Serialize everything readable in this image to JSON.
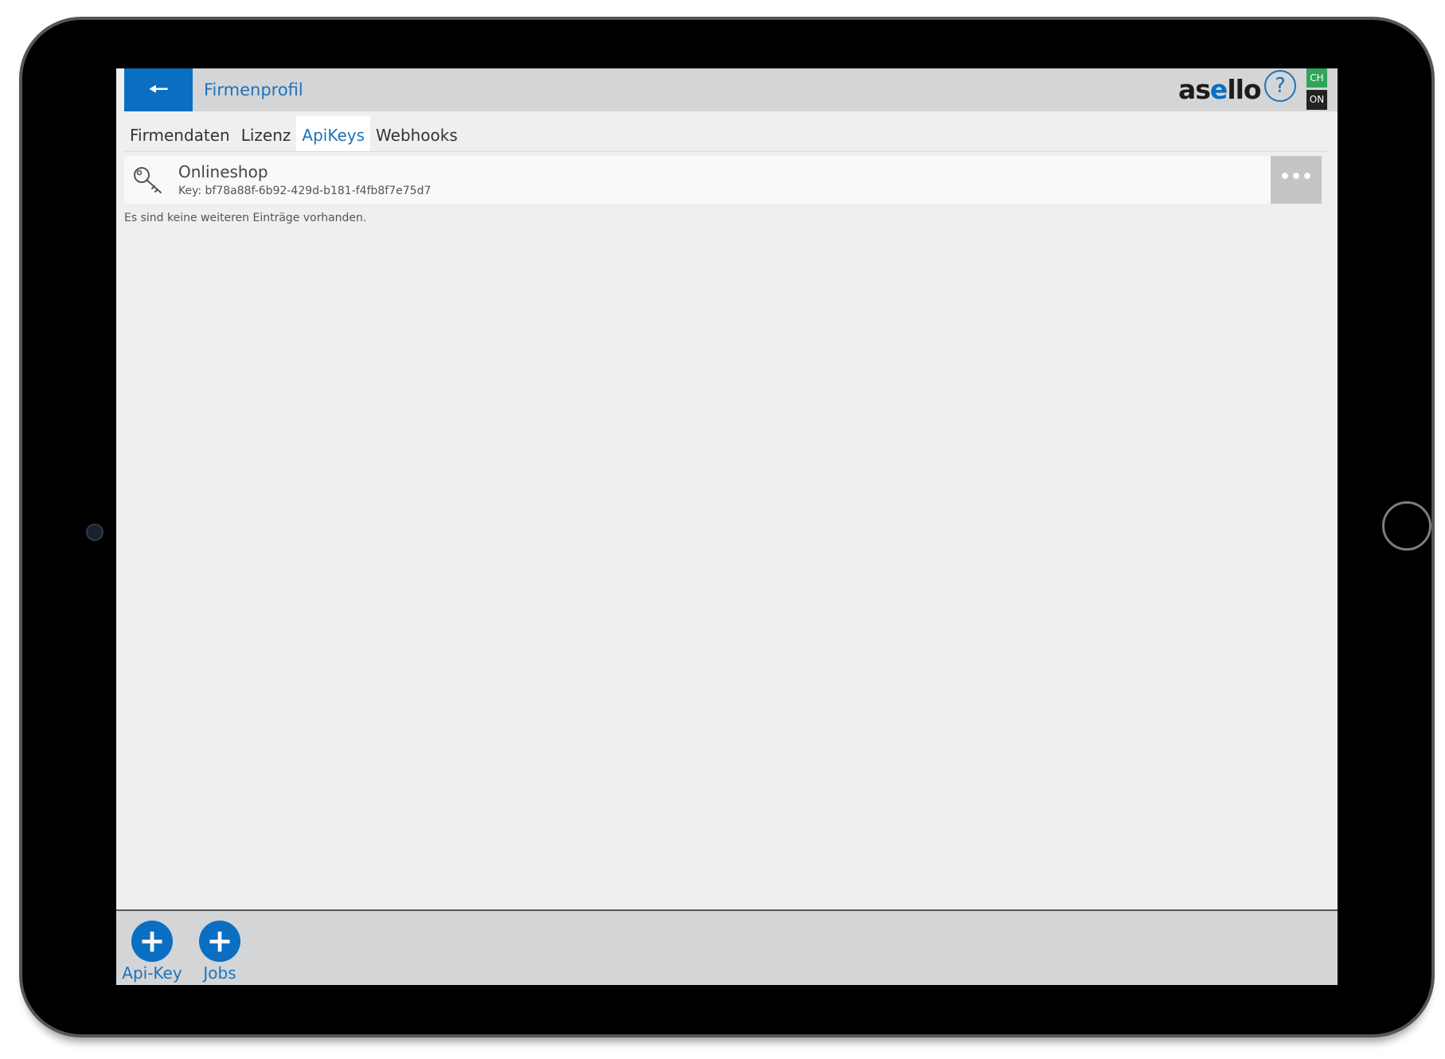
{
  "header": {
    "back_icon": "arrow-left-icon",
    "title": "Firmenprofil",
    "logo": {
      "before": "as",
      "accent": "e",
      "after": "llo"
    },
    "help_glyph": "?",
    "badges": {
      "ch": "CH",
      "on": "ON"
    }
  },
  "tabs": [
    {
      "label": "Firmendaten",
      "active": false
    },
    {
      "label": "Lizenz",
      "active": false
    },
    {
      "label": "ApiKeys",
      "active": true
    },
    {
      "label": "Webhooks",
      "active": false
    }
  ],
  "list": {
    "items": [
      {
        "icon": "key-icon",
        "title": "Onlineshop",
        "key": "Key: bf78a88f-6b92-429d-b181-f4fb8f7e75d7",
        "more_label": "•••"
      }
    ],
    "empty_note": "Es sind keine weiteren Einträge vorhanden."
  },
  "footer": {
    "actions": [
      {
        "icon": "plus-icon",
        "label": "Api-Key"
      },
      {
        "icon": "plus-icon",
        "label": "Jobs"
      }
    ]
  },
  "colors": {
    "accent": "#0a6fc2",
    "header_bg": "#d4d5d7",
    "screen_bg": "#eeefee",
    "badge_green": "#2fa45a",
    "badge_dark": "#222222"
  }
}
